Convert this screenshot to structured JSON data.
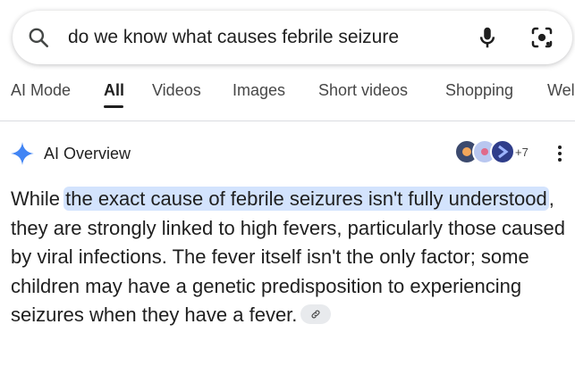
{
  "search": {
    "query": "do we know what causes febrile seizure",
    "icons": [
      "search-icon",
      "mic-icon",
      "lens-icon"
    ]
  },
  "tabs": [
    {
      "label": "AI Mode",
      "active": false
    },
    {
      "label": "All",
      "active": true
    },
    {
      "label": "Videos",
      "active": false
    },
    {
      "label": "Images",
      "active": false
    },
    {
      "label": "Short videos",
      "active": false
    },
    {
      "label": "Shopping",
      "active": false
    },
    {
      "label": "Wel",
      "active": false
    }
  ],
  "ai_overview": {
    "title": "AI Overview",
    "source_count": "+7",
    "highlighted": "the exact cause of febrile seizures isn't fully understood",
    "text_before": "While ",
    "text_after": ", they are strongly linked to high fevers, particularly those caused by viral infections. The fever itself isn't the only factor; some children may have a genetic predisposition to experiencing seizures when they have a fever."
  },
  "colors": {
    "accent": "#1f1f1f",
    "highlight": "#d3e3fd",
    "sparkle": "#4285f4"
  }
}
